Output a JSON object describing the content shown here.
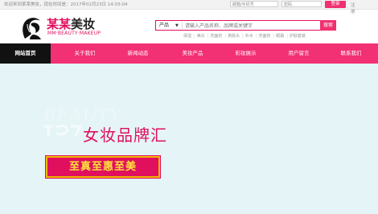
{
  "topbar": {
    "welcome": "欢迎来到某某美妆，现在时间是：2017年02月23日 14:03:04",
    "email_placeholder": "邮箱/手机号",
    "password_placeholder": "密码",
    "login_label": "登录",
    "register_label": "注册"
  },
  "logo": {
    "title_part1": "某某",
    "title_part2": "美妆",
    "subtitle": "MM·BEAUTY·MAKEUP"
  },
  "search": {
    "category": "产品",
    "placeholder": "请输入产品名称、品牌或关键字",
    "button_label": "搜索",
    "hot_terms": [
      "保湿",
      "美白",
      "洗面奶",
      "爽肤水",
      "补水",
      "洗面奶",
      "眼霜",
      "护肤套装"
    ]
  },
  "nav": {
    "items": [
      {
        "label": "网站首页",
        "active": true
      },
      {
        "label": "关于我们",
        "active": false
      },
      {
        "label": "新闻动态",
        "active": false
      },
      {
        "label": "美妆产品",
        "active": false
      },
      {
        "label": "彩妆展示",
        "active": false
      },
      {
        "label": "用户留言",
        "active": false
      },
      {
        "label": "联系我们",
        "active": false
      }
    ]
  },
  "banner": {
    "beauty_text": "BEAUTY",
    "headline": "女妆品牌汇",
    "slogan": "至真至惠至美"
  },
  "colors": {
    "brand_pink": "#e0105e",
    "nav_pink": "#f23074",
    "banner_bg": "#e5f4f7",
    "slogan_text": "#ffe33a",
    "slogan_border": "#f2b800"
  }
}
